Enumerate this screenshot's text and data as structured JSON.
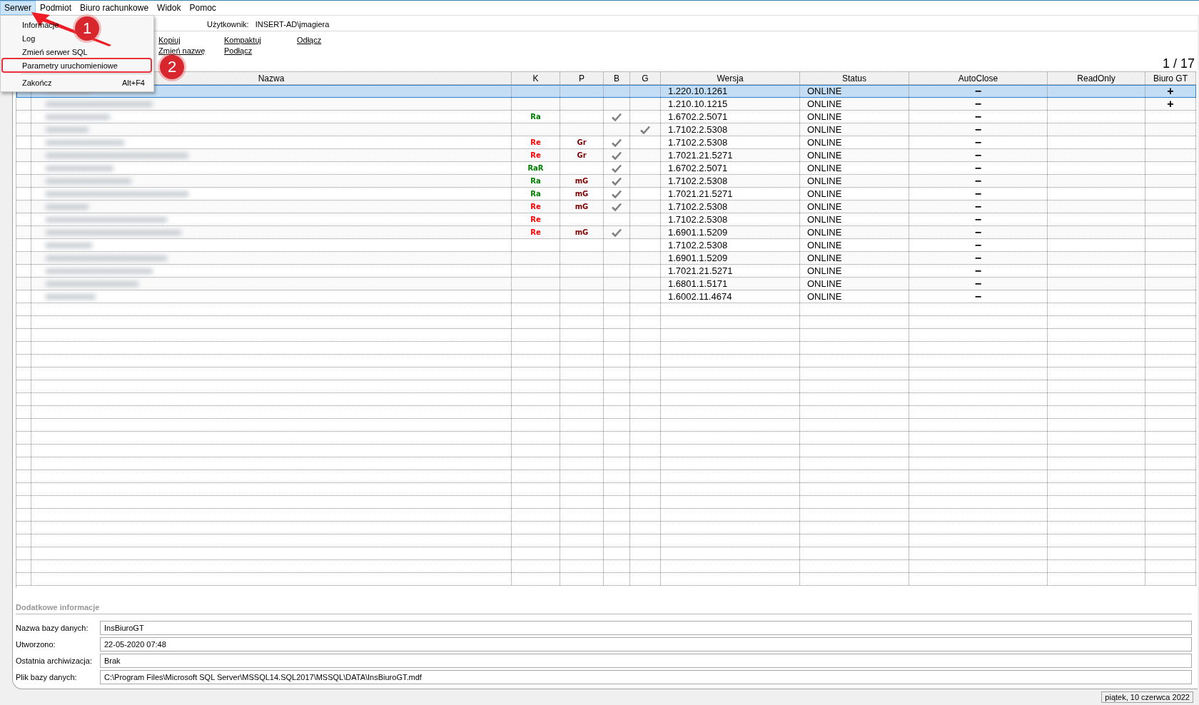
{
  "menu_bar": [
    {
      "label": "Serwer",
      "selected": true
    },
    {
      "label": "Podmiot",
      "selected": false
    },
    {
      "label": "Biuro rachunkowe",
      "selected": false
    },
    {
      "label": "Widok",
      "selected": false
    },
    {
      "label": "Pomoc",
      "selected": false
    }
  ],
  "server_menu": [
    {
      "label": "Informacje"
    },
    {
      "label": "Log"
    },
    {
      "label": "Zmień serwer SQL"
    },
    {
      "label": "Parametry uruchomieniowe",
      "highlighted": true
    },
    {
      "label": "Zakończ",
      "shortcut": "Alt+F4",
      "separator_before": true
    }
  ],
  "annotations": [
    {
      "kind": "arrow"
    },
    {
      "kind": "badge",
      "text": "1"
    },
    {
      "kind": "badge",
      "text": "2"
    }
  ],
  "user": {
    "label": "Użytkownik:",
    "value": "INSERT-AD\\jmagiera"
  },
  "actions": [
    [
      "Kopiuj",
      "Zmień nazwę"
    ],
    [
      "Kompaktuj",
      "Podłącz"
    ],
    [
      "Odłącz"
    ]
  ],
  "pager": "1 / 17",
  "table": {
    "columns": [
      "",
      "Nazwa",
      "K",
      "P",
      "B",
      "G",
      "Wersja",
      "Status",
      "AutoClose",
      "ReadOnly",
      "Biuro GT"
    ],
    "rows": [
      {
        "selected": true,
        "name_blurred": true,
        "k": null,
        "p": null,
        "b": false,
        "g": false,
        "version": "1.220.10.1261",
        "status": "ONLINE",
        "autoclose": "−",
        "biuro_gt": "+"
      },
      {
        "selected": false,
        "name_blurred": true,
        "k": null,
        "p": null,
        "b": false,
        "g": false,
        "version": "1.210.10.1215",
        "status": "ONLINE",
        "autoclose": "−",
        "biuro_gt": "+"
      },
      {
        "selected": false,
        "name_blurred": true,
        "k": {
          "text": "Ra",
          "color": "#008000"
        },
        "p": null,
        "b": true,
        "g": false,
        "version": "1.6702.2.5071",
        "status": "ONLINE",
        "autoclose": "−"
      },
      {
        "selected": false,
        "name_blurred": true,
        "k": null,
        "p": null,
        "b": false,
        "g": true,
        "version": "1.7102.2.5308",
        "status": "ONLINE",
        "autoclose": "−"
      },
      {
        "selected": false,
        "name_blurred": true,
        "k": {
          "text": "Re",
          "color": "#ff0000"
        },
        "p": {
          "text": "Gr",
          "color": "#800000"
        },
        "b": true,
        "g": false,
        "version": "1.7102.2.5308",
        "status": "ONLINE",
        "autoclose": "−"
      },
      {
        "selected": false,
        "name_blurred": true,
        "k": {
          "text": "Re",
          "color": "#ff0000"
        },
        "p": {
          "text": "Gr",
          "color": "#800000"
        },
        "b": true,
        "g": false,
        "version": "1.7021.21.5271",
        "status": "ONLINE",
        "autoclose": "−"
      },
      {
        "selected": false,
        "name_blurred": true,
        "k": {
          "text": "RaR",
          "color": "#008000"
        },
        "p": null,
        "b": true,
        "g": false,
        "version": "1.6702.2.5071",
        "status": "ONLINE",
        "autoclose": "−"
      },
      {
        "selected": false,
        "name_blurred": true,
        "k": {
          "text": "Ra",
          "color": "#008000"
        },
        "p": {
          "text": "mG",
          "color": "#800000"
        },
        "b": true,
        "g": false,
        "version": "1.7102.2.5308",
        "status": "ONLINE",
        "autoclose": "−"
      },
      {
        "selected": false,
        "name_blurred": true,
        "k": {
          "text": "Ra",
          "color": "#008000"
        },
        "p": {
          "text": "mG",
          "color": "#800000"
        },
        "b": true,
        "g": false,
        "version": "1.7021.21.5271",
        "status": "ONLINE",
        "autoclose": "−"
      },
      {
        "selected": false,
        "name_blurred": true,
        "k": {
          "text": "Re",
          "color": "#ff0000"
        },
        "p": {
          "text": "mG",
          "color": "#800000"
        },
        "b": true,
        "g": false,
        "version": "1.7102.2.5308",
        "status": "ONLINE",
        "autoclose": "−"
      },
      {
        "selected": false,
        "name_blurred": true,
        "k": {
          "text": "Re",
          "color": "#ff0000"
        },
        "p": null,
        "b": false,
        "g": false,
        "version": "1.7102.2.5308",
        "status": "ONLINE",
        "autoclose": "−"
      },
      {
        "selected": false,
        "name_blurred": true,
        "k": {
          "text": "Re",
          "color": "#ff0000"
        },
        "p": {
          "text": "mG",
          "color": "#800000"
        },
        "b": true,
        "g": false,
        "version": "1.6901.1.5209",
        "status": "ONLINE",
        "autoclose": "−"
      },
      {
        "selected": false,
        "name_blurred": true,
        "k": null,
        "p": null,
        "b": false,
        "g": false,
        "version": "1.7102.2.5308",
        "status": "ONLINE",
        "autoclose": "−"
      },
      {
        "selected": false,
        "name_blurred": true,
        "k": null,
        "p": null,
        "b": false,
        "g": false,
        "version": "1.6901.1.5209",
        "status": "ONLINE",
        "autoclose": "−"
      },
      {
        "selected": false,
        "name_blurred": true,
        "k": null,
        "p": null,
        "b": false,
        "g": false,
        "version": "1.7021.21.5271",
        "status": "ONLINE",
        "autoclose": "−"
      },
      {
        "selected": false,
        "name_blurred": true,
        "k": null,
        "p": null,
        "b": false,
        "g": false,
        "version": "1.6801.1.5171",
        "status": "ONLINE",
        "autoclose": "−"
      },
      {
        "selected": false,
        "name_blurred": true,
        "k": null,
        "p": null,
        "b": false,
        "g": false,
        "version": "1.6002.11.4674",
        "status": "ONLINE",
        "autoclose": "−"
      }
    ]
  },
  "details": {
    "title": "Dodatkowe informacje",
    "fields": [
      {
        "label": "Nazwa bazy danych:",
        "value": "InsBiuroGT"
      },
      {
        "label": "Utworzono:",
        "value": "22-05-2020 07:48"
      },
      {
        "label": "Ostatnia archiwizacja:",
        "value": "Brak"
      },
      {
        "label": "Plik bazy danych:",
        "value": "C:\\Program Files\\Microsoft SQL Server\\MSSQL14.SQL2017\\MSSQL\\DATA\\InsBiuroGT.mdf"
      }
    ]
  },
  "status_bar": {
    "date": "piątek, 10 czerwca 2022"
  }
}
